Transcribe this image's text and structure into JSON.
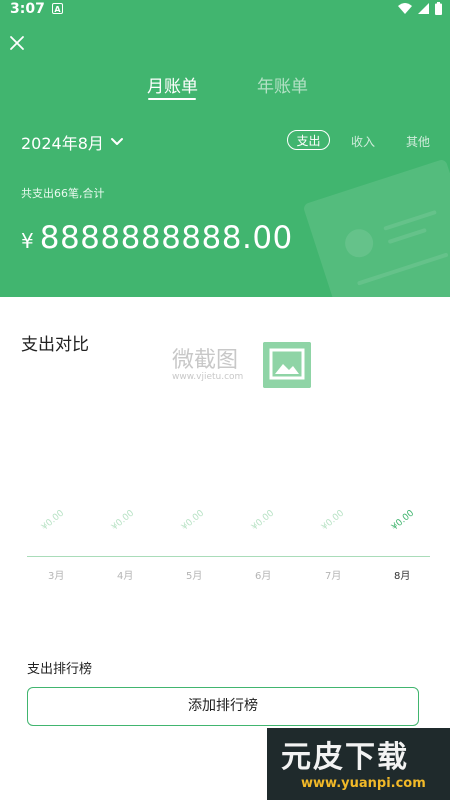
{
  "status_bar": {
    "time": "3:07",
    "notification_icon_label": "A"
  },
  "tabs": [
    {
      "label": "月账单",
      "active": true
    },
    {
      "label": "年账单",
      "active": false
    }
  ],
  "date_selector": {
    "label": "2024年8月"
  },
  "type_filter": {
    "selected": "支出",
    "income": "收入",
    "other": "其他"
  },
  "summary": {
    "text": "共支出66笔,合计"
  },
  "amount": {
    "currency": "¥",
    "value": "8888888888.00"
  },
  "compare": {
    "title": "支出对比",
    "months": [
      {
        "label": "3月",
        "value": "¥0.00",
        "active": false
      },
      {
        "label": "4月",
        "value": "¥0.00",
        "active": false
      },
      {
        "label": "5月",
        "value": "¥0.00",
        "active": false
      },
      {
        "label": "6月",
        "value": "¥0.00",
        "active": false
      },
      {
        "label": "7月",
        "value": "¥0.00",
        "active": false
      },
      {
        "label": "8月",
        "value": "¥0.00",
        "active": true
      }
    ]
  },
  "watermark": {
    "text": "微截图",
    "url": "www.vjietu.com"
  },
  "ranking": {
    "title": "支出排行榜",
    "add_button": "添加排行榜"
  },
  "brand_watermark": {
    "text_main": "元皮下载",
    "url": "www.yuanpi.com"
  },
  "colors": {
    "accent": "#41b56f",
    "light_accent": "#a9dcb9"
  }
}
